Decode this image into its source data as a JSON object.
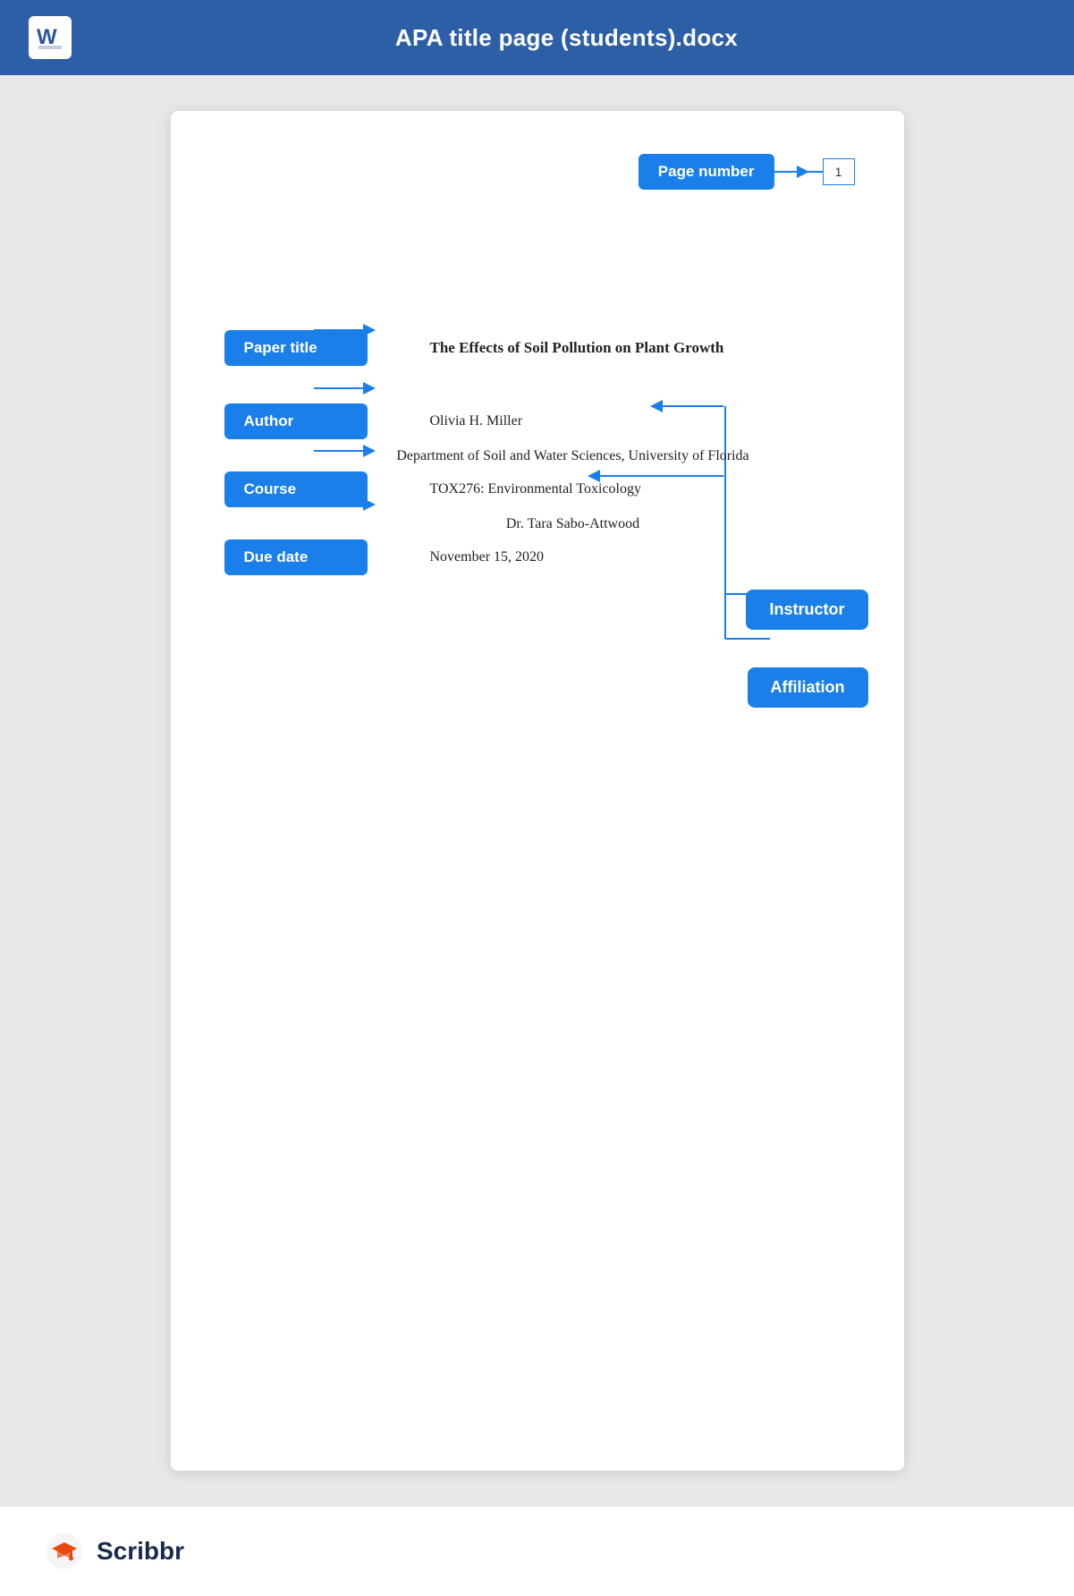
{
  "header": {
    "title": "APA title page (students).docx",
    "word_icon_label": "W"
  },
  "document": {
    "page_number_label": "Page number",
    "page_number_value": "1",
    "paper_title_label": "Paper title",
    "paper_title_text": "The Effects of Soil Pollution on Plant Growth",
    "author_label": "Author",
    "author_text": "Olivia H. Miller",
    "affiliation_text": "Department of Soil and Water Sciences, University of Florida",
    "course_label": "Course",
    "course_text": "TOX276: Environmental Toxicology",
    "instructor_text": "Dr. Tara Sabo-Attwood",
    "due_date_label": "Due date",
    "due_date_text": "November 15, 2020",
    "instructor_label": "Instructor",
    "affiliation_label": "Affiliation"
  },
  "footer": {
    "brand": "Scribbr"
  },
  "colors": {
    "badge_blue": "#1a7fe8",
    "header_blue": "#2d5fa6",
    "text_dark": "#1a2a4a",
    "line_blue": "#1a7fe8"
  }
}
